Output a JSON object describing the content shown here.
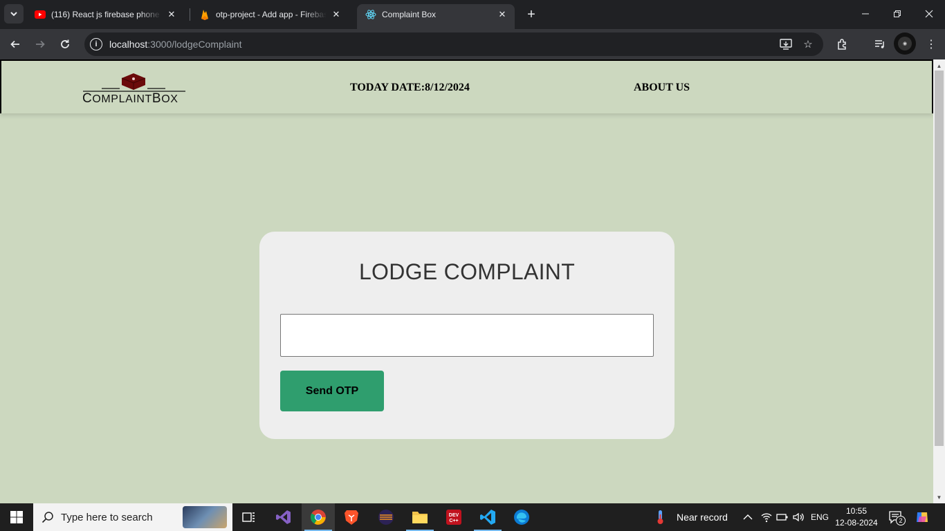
{
  "browser": {
    "tabs": [
      {
        "title": "(116) React js firebase phone au",
        "icon": "youtube-icon",
        "active": false
      },
      {
        "title": "otp-project - Add app - Firebas",
        "icon": "firebase-icon",
        "active": false
      },
      {
        "title": "Complaint Box",
        "icon": "react-icon",
        "active": true
      }
    ],
    "url_host": "localhost",
    "url_path": ":3000/lodgeComplaint"
  },
  "site": {
    "logo_text_first": "C",
    "logo_text_mid": "OMPLAINT",
    "logo_text_second": "B",
    "logo_text_end": "OX",
    "today_label": "TODAY DATE:8/12/2024",
    "about_label": "ABOUT US"
  },
  "form": {
    "heading": "LODGE COMPLAINT",
    "input_value": "",
    "input_placeholder": "",
    "send_button": "Send OTP"
  },
  "taskbar": {
    "search_placeholder": "Type here to search",
    "weather": "Near record",
    "language": "ENG",
    "time": "10:55",
    "date": "12-08-2024",
    "notification_count": "2"
  },
  "colors": {
    "page_bg": "#ccd8bf",
    "card_bg": "#eeeeee",
    "button": "#2f9e6e",
    "logo_box": "#6b0a0a"
  }
}
